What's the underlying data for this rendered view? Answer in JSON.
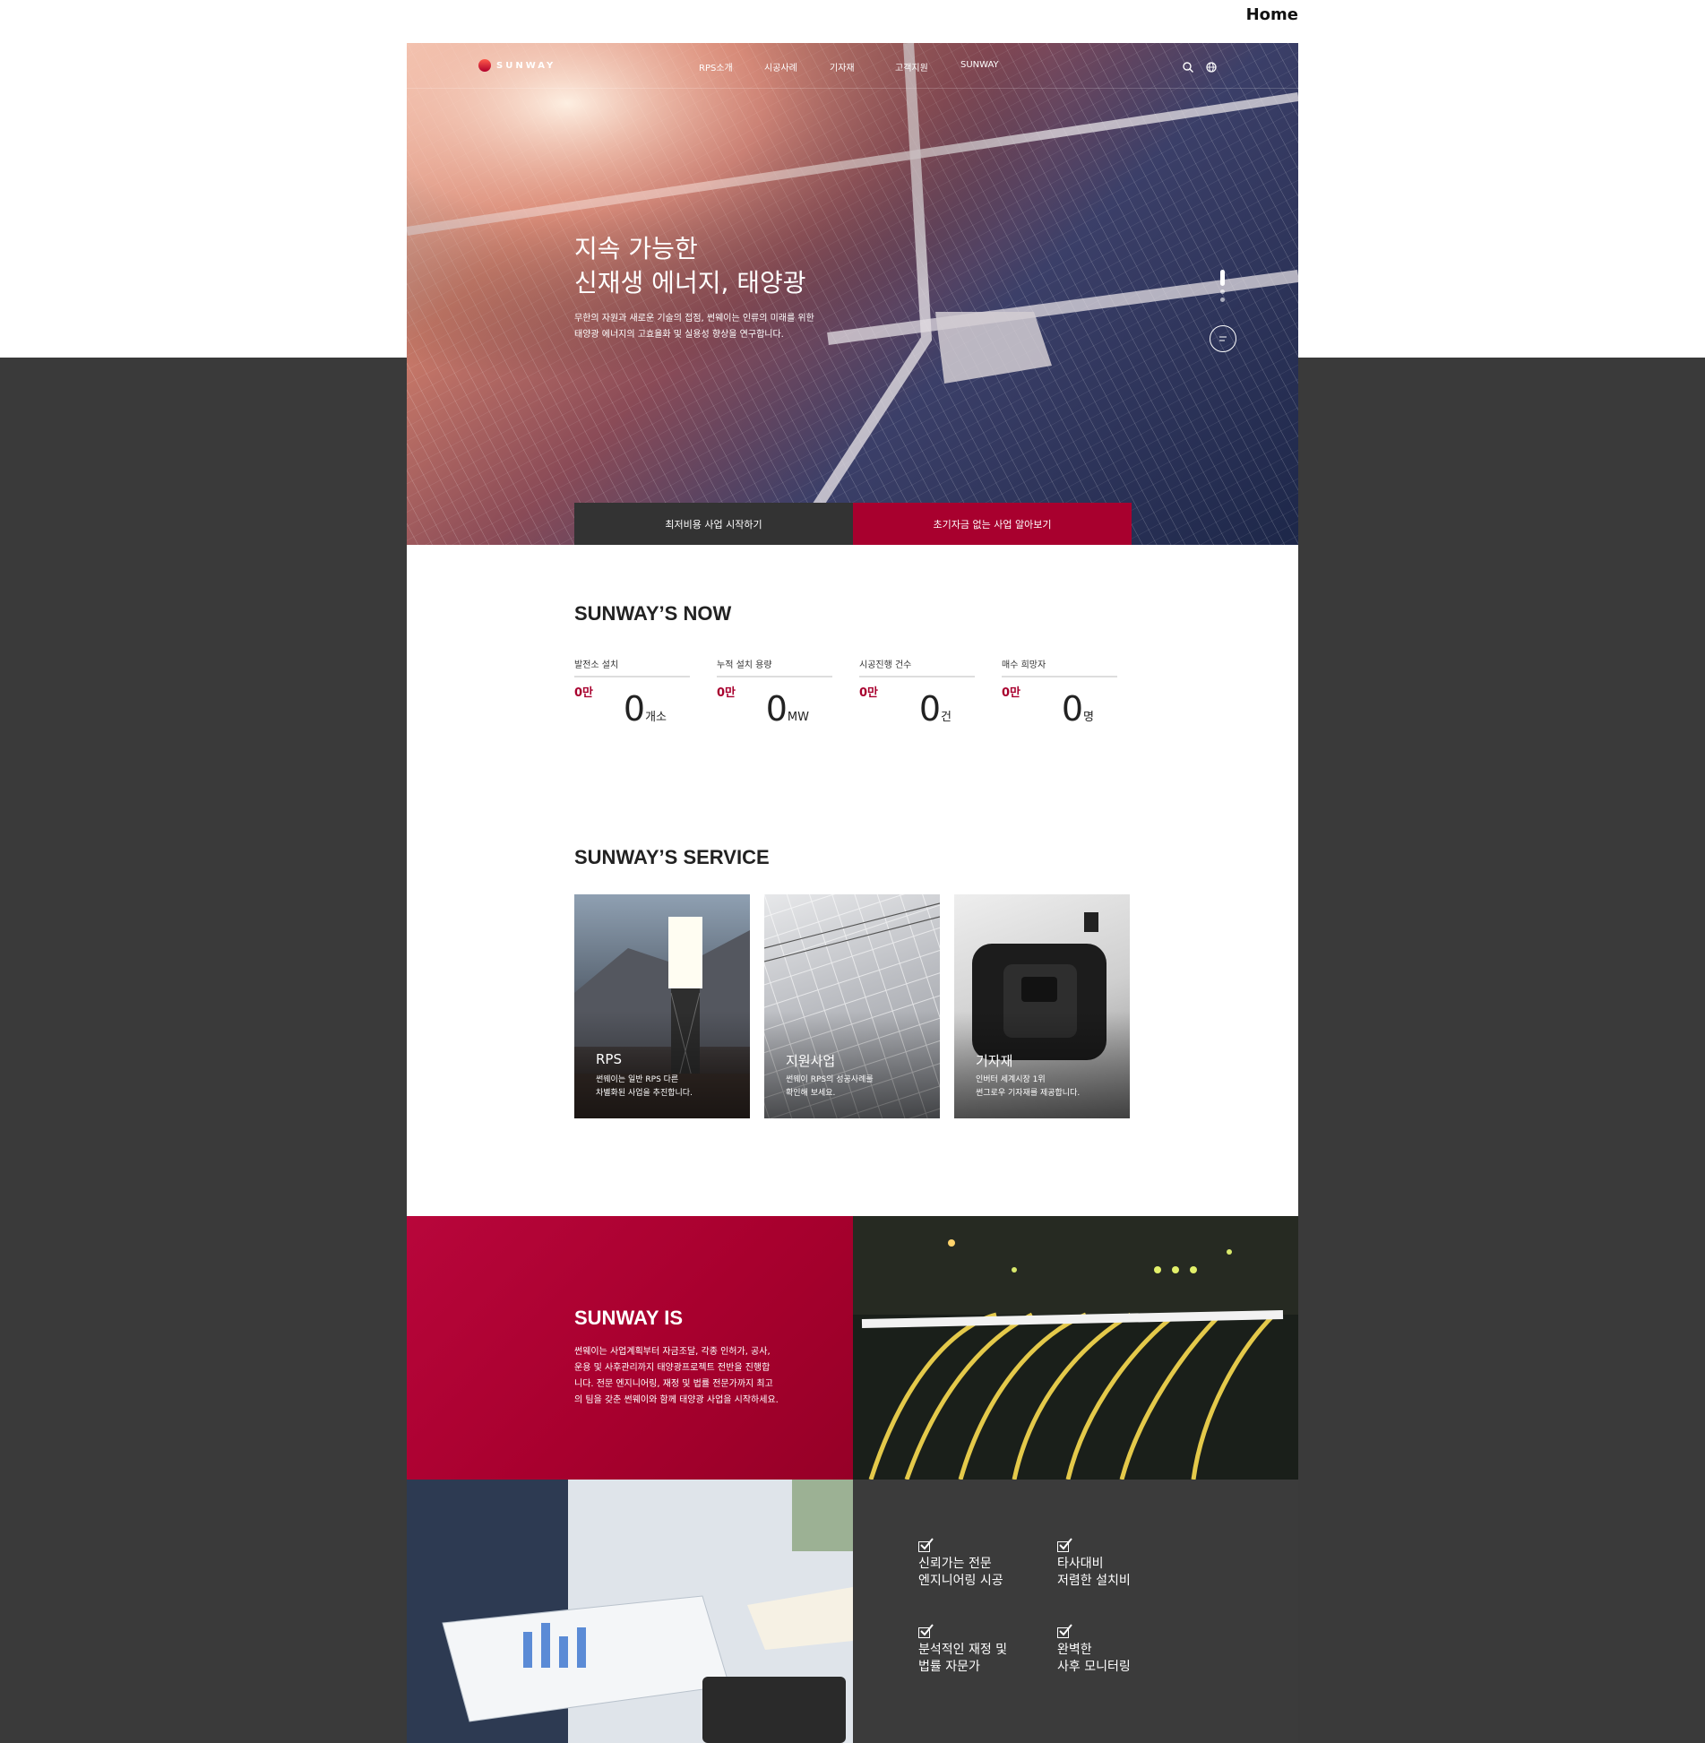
{
  "page": {
    "corner_label": "Home"
  },
  "header": {
    "logo_text": "SUNWAY",
    "menu": [
      "RPS소개",
      "시공사례",
      "기자재",
      "고객지원",
      "SUNWAY"
    ],
    "icons": [
      "search-icon",
      "globe-icon"
    ]
  },
  "hero": {
    "title_line1": "지속 가능한",
    "title_line2": "신재생 에너지, 태양광",
    "desc_line1": "무한의 자원과 새로운 기술의 접점, 썬웨이는 인류의 미래를 위한",
    "desc_line2": "태양광 에너지의 고효율화 및 실용성 향상을 연구합니다.",
    "cta_left": "최저비용 사업 시작하기",
    "cta_right": "초기자금 없는 사업 알아보기"
  },
  "now": {
    "title": "SUNWAY’S NOW",
    "stats": [
      {
        "label": "발전소 설치",
        "small": "0만",
        "value": "0",
        "unit": "개소"
      },
      {
        "label": "누적 설치 용량",
        "small": "0만",
        "value": "0",
        "unit": "MW"
      },
      {
        "label": "시공진행 건수",
        "small": "0만",
        "value": "0",
        "unit": "건"
      },
      {
        "label": "매수 희망자",
        "small": "0만",
        "value": "0",
        "unit": "명"
      }
    ]
  },
  "service": {
    "title": "SUNWAY’S SERVICE",
    "cards": [
      {
        "title": "RPS",
        "desc1": "썬웨이는 일반 RPS 다른",
        "desc2": "차별화된 사업을 추진합니다."
      },
      {
        "title": "지원사업",
        "desc1": "썬웨이 RPS의 성공사례를",
        "desc2": "확인해 보세요."
      },
      {
        "title": "기자재",
        "desc1": "인버터 세계시장 1위",
        "desc2": "썬그로우 기자재를 제공합니다."
      }
    ]
  },
  "about": {
    "title": "SUNWAY IS",
    "desc_line1": "썬웨이는 사업계획부터 자금조달, 각종 인허가, 공사,",
    "desc_line2": "운용 및 사후관리까지 태양광프로젝트 전반을 진행합",
    "desc_line3": "니다. 전문 엔지니어링, 재정 및 법률 전문가까지 최고",
    "desc_line4": "의 팀을 갖춘 썬웨이와 함께 태양광 사업을 시작하세요."
  },
  "features": [
    {
      "line1": "신뢰가는 전문",
      "line2": "엔지니어링 시공"
    },
    {
      "line1": "타사대비",
      "line2": "저렴한 설치비"
    },
    {
      "line1": "분석적인 재정 및",
      "line2": "법률 자문가"
    },
    {
      "line1": "완벽한",
      "line2": "사후 모니터링"
    }
  ],
  "colors": {
    "brand_red": "#a8002e",
    "dark": "#3a3a3a"
  }
}
